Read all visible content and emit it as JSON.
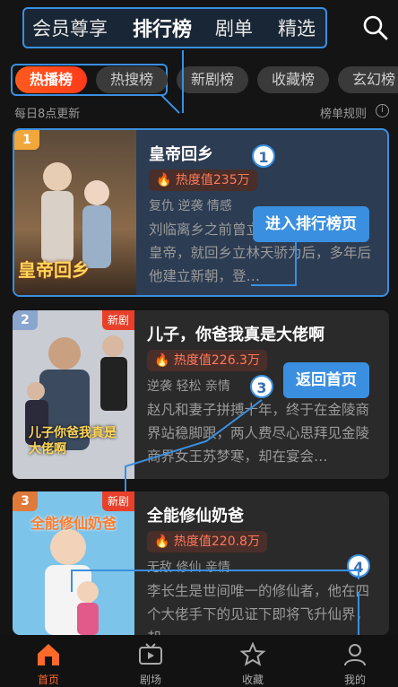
{
  "topnav": {
    "tabs": [
      "会员尊享",
      "排行榜",
      "剧单",
      "精选"
    ],
    "active_tab": "排行榜"
  },
  "chips": [
    "热播榜",
    "热搜榜",
    "新剧榜",
    "收藏榜",
    "玄幻榜"
  ],
  "update_note": "每日8点更新",
  "rules_label": "榜单规则",
  "info_glyph": "i",
  "cards": [
    {
      "rank": "1",
      "title": "皇帝回乡",
      "heat": "热度值235万",
      "tags": "复仇  逆袭  情感",
      "synopsis": "刘临离乡之前曾立下约定，待他做了皇帝，就回乡立林天骄为后，多年后他建立新朝，登…",
      "poster_caption": "皇帝回乡",
      "rank_color": "#f2a73b"
    },
    {
      "rank": "2",
      "new_label": "新剧",
      "title": "儿子，你爸我真是大佬啊",
      "heat": "热度值226.3万",
      "tags": "逆袭  轻松  亲情",
      "synopsis": "赵凡和妻子拼搏十年，终于在金陵商界站稳脚跟，两人费尽心思拜见金陵商界女王苏梦寒，却在宴会…",
      "poster_caption": "儿子你爸我真是大佬啊",
      "rank_color": "#8aa6cf"
    },
    {
      "rank": "3",
      "new_label": "新剧",
      "title": "全能修仙奶爸",
      "heat": "热度值220.8万",
      "tags": "无敌  修仙  亲情",
      "synopsis": "李长生是世间唯一的修仙者，他在四个大佬手下的见证下即将飞升仙界，却…",
      "poster_caption": "全能修仙奶爸",
      "rank_color": "#e07a3a"
    }
  ],
  "overlay_buttons": {
    "enter_rank": "进入排行榜页",
    "back_home": "返回首页"
  },
  "markers": [
    "1",
    "3",
    "4"
  ],
  "bottomnav": [
    {
      "label": "首页",
      "icon": "home-icon"
    },
    {
      "label": "剧场",
      "icon": "tv-icon"
    },
    {
      "label": "收藏",
      "icon": "star-icon"
    },
    {
      "label": "我的",
      "icon": "person-icon"
    }
  ],
  "colors": {
    "accent": "#3a8fe0",
    "hot": "#ff5a1f",
    "background": "#141414"
  }
}
